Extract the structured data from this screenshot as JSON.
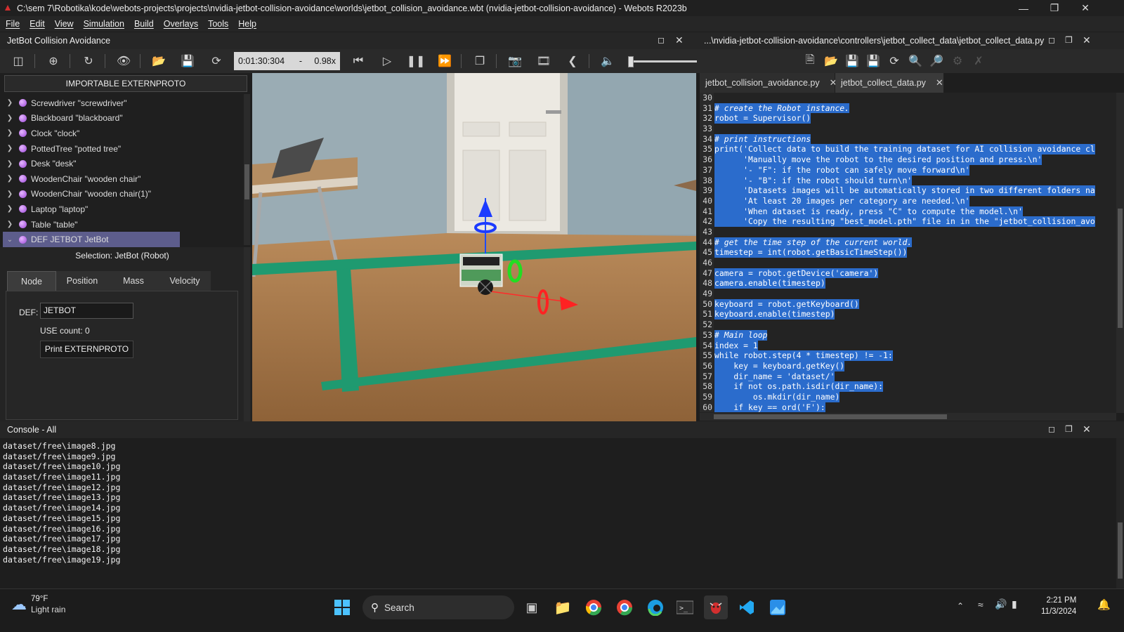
{
  "window": {
    "title": "C:\\sem 7\\Robotika\\kode\\webots-projects\\projects\\nvidia-jetbot-collision-avoidance\\worlds\\jetbot_collision_avoidance.wbt (nvidia-jetbot-collision-avoidance) - Webots R2023b"
  },
  "menu": [
    "File",
    "Edit",
    "View",
    "Simulation",
    "Build",
    "Overlays",
    "Tools",
    "Help"
  ],
  "scene": {
    "title": "JetBot Collision Avoidance",
    "time": "0:01:30:304",
    "time_sep": "-",
    "speed": "0.98x",
    "importable_label": "IMPORTABLE EXTERNPROTO",
    "tree": [
      {
        "label": "Screwdriver \"screwdriver\"",
        "expanded": false
      },
      {
        "label": "Blackboard \"blackboard\"",
        "expanded": false
      },
      {
        "label": "Clock \"clock\"",
        "expanded": false
      },
      {
        "label": "PottedTree \"potted tree\"",
        "expanded": false
      },
      {
        "label": "Desk \"desk\"",
        "expanded": false
      },
      {
        "label": "WoodenChair \"wooden chair\"",
        "expanded": false
      },
      {
        "label": "WoodenChair \"wooden chair(1)\"",
        "expanded": false
      },
      {
        "label": "Laptop \"laptop\"",
        "expanded": false
      },
      {
        "label": "Table \"table\"",
        "expanded": false
      },
      {
        "label": "DEF JETBOT JetBot",
        "expanded": true
      }
    ],
    "selection_label": "Selection: JetBot (Robot)",
    "tabs": [
      "Node",
      "Position",
      "Mass",
      "Velocity"
    ],
    "active_tab": "Node",
    "def_label": "DEF:",
    "def_value": "JETBOT",
    "use_count": "USE count: 0",
    "print_button": "Print EXTERNPROTO"
  },
  "editor": {
    "path": "...\\nvidia-jetbot-collision-avoidance\\controllers\\jetbot_collect_data\\jetbot_collect_data.py",
    "tabs": [
      {
        "label": "jetbot_collision_avoidance.py",
        "active": false
      },
      {
        "label": "jetbot_collect_data.py",
        "active": true
      }
    ],
    "lines": [
      {
        "n": "30",
        "code": ""
      },
      {
        "n": "31",
        "code": "# create the Robot instance.",
        "comment": true
      },
      {
        "n": "32",
        "code": "robot = Supervisor()"
      },
      {
        "n": "33",
        "code": ""
      },
      {
        "n": "34",
        "code": "# print instructions",
        "comment": true
      },
      {
        "n": "35",
        "code": "print('Collect data to build the training dataset for AI collision avoidance cl"
      },
      {
        "n": "36",
        "code": "      'Manually move the robot to the desired position and press:\\n'"
      },
      {
        "n": "37",
        "code": "      '- \"F\": if the robot can safely move forward\\n'"
      },
      {
        "n": "38",
        "code": "      '- \"B\": if the robot should turn\\n'"
      },
      {
        "n": "39",
        "code": "      'Datasets images will be automatically stored in two different folders na"
      },
      {
        "n": "40",
        "code": "      'At least 20 images per category are needed.\\n'"
      },
      {
        "n": "41",
        "code": "      'When dataset is ready, press \"C\" to compute the model.\\n'"
      },
      {
        "n": "42",
        "code": "      'Copy the resulting \"best_model.pth\" file in in the \"jetbot_collision_avo"
      },
      {
        "n": "43",
        "code": ""
      },
      {
        "n": "44",
        "code": "# get the time step of the current world.",
        "comment": true
      },
      {
        "n": "45",
        "code": "timestep = int(robot.getBasicTimeStep())"
      },
      {
        "n": "46",
        "code": ""
      },
      {
        "n": "47",
        "code": "camera = robot.getDevice('camera')"
      },
      {
        "n": "48",
        "code": "camera.enable(timestep)"
      },
      {
        "n": "49",
        "code": ""
      },
      {
        "n": "50",
        "code": "keyboard = robot.getKeyboard()"
      },
      {
        "n": "51",
        "code": "keyboard.enable(timestep)"
      },
      {
        "n": "52",
        "code": ""
      },
      {
        "n": "53",
        "code": "# Main loop",
        "comment": true
      },
      {
        "n": "54",
        "code": "index = 1"
      },
      {
        "n": "55",
        "code": "while robot.step(4 * timestep) != -1:"
      },
      {
        "n": "56",
        "code": "    key = keyboard.getKey()"
      },
      {
        "n": "57",
        "code": "    dir_name = 'dataset/'"
      },
      {
        "n": "58",
        "code": "    if not os.path.isdir(dir_name):"
      },
      {
        "n": "59",
        "code": "        os.mkdir(dir_name)"
      },
      {
        "n": "60",
        "code": "    if key == ord('F'):"
      }
    ]
  },
  "console": {
    "title": "Console - All",
    "lines": [
      "dataset/free\\image8.jpg",
      "dataset/free\\image9.jpg",
      "dataset/free\\image10.jpg",
      "dataset/free\\image11.jpg",
      "dataset/free\\image12.jpg",
      "dataset/free\\image13.jpg",
      "dataset/free\\image14.jpg",
      "dataset/free\\image15.jpg",
      "dataset/free\\image16.jpg",
      "dataset/free\\image17.jpg",
      "dataset/free\\image18.jpg",
      "dataset/free\\image19.jpg"
    ]
  },
  "taskbar": {
    "temperature": "79°F",
    "condition": "Light rain",
    "search_label": "Search",
    "time": "2:21 PM",
    "date": "11/3/2024"
  },
  "colors": {
    "selection": "#2b6ccc",
    "tree_selected": "#5d5d8c",
    "floor_tape": "#1f9a70"
  }
}
